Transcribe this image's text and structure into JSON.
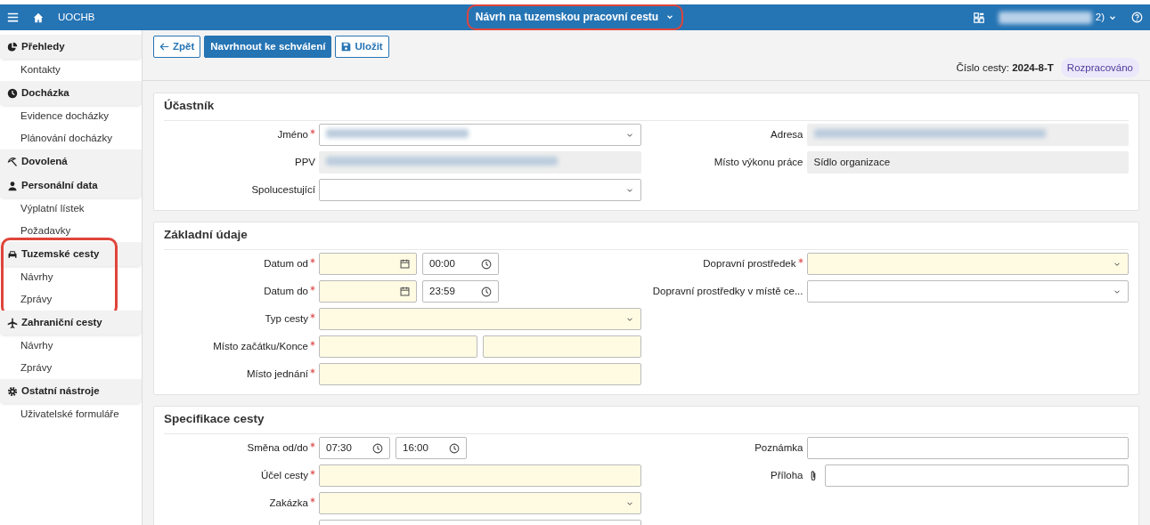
{
  "topbar": {
    "app_name": "UOCHB",
    "title": "Návrh na tuzemskou pracovní cestu",
    "title_highlighted": true,
    "user_redacted": true,
    "user_visible_text": "2)"
  },
  "sidebar": [
    {
      "label": "Přehledy",
      "highlighted": false,
      "items": [
        {
          "label": "Kontakty"
        }
      ]
    },
    {
      "label": "Docházka",
      "highlighted": false,
      "items": [
        {
          "label": "Evidence docházky"
        },
        {
          "label": "Plánování docházky"
        }
      ]
    },
    {
      "label": "Dovolená",
      "highlighted": false
    },
    {
      "label": "Personální data",
      "highlighted": false,
      "items": [
        {
          "label": "Výplatní lístek"
        },
        {
          "label": "Požadavky"
        }
      ]
    },
    {
      "label": "Tuzemské cesty",
      "highlighted": true,
      "items": [
        {
          "label": "Návrhy"
        },
        {
          "label": "Zprávy"
        }
      ]
    },
    {
      "label": "Zahraniční cesty",
      "highlighted": false,
      "items": [
        {
          "label": "Návrhy"
        },
        {
          "label": "Zprávy"
        }
      ]
    },
    {
      "label": "Ostatní nástroje",
      "highlighted": false,
      "items": [
        {
          "label": "Uživatelské formuláře"
        }
      ]
    }
  ],
  "toolbar": [
    {
      "label": "Zpět",
      "kind": "back"
    },
    {
      "label": "Navrhnout ke schválení",
      "kind": "primary"
    },
    {
      "label": "Uložit",
      "kind": "save"
    }
  ],
  "trip_number_label": "Číslo cesty:",
  "trip_number": "2024-8-T",
  "status": "Rozpracováno",
  "sections": [
    {
      "title": "Účastník",
      "left": [
        {
          "label": "Jméno",
          "required": true,
          "fields": [
            {
              "kind": "select",
              "redacted": true
            }
          ]
        },
        {
          "label": "PPV",
          "required": false,
          "fields": [
            {
              "kind": "readonly",
              "redacted": true
            }
          ]
        },
        {
          "label": "Spolucestující",
          "required": false,
          "fields": [
            {
              "kind": "select"
            }
          ]
        }
      ],
      "right": [
        {
          "label": "Adresa",
          "required": false,
          "fields": [
            {
              "kind": "readonly",
              "redacted": true
            }
          ]
        },
        {
          "label": "Místo výkonu práce",
          "required": false,
          "fields": [
            {
              "kind": "readonly",
              "value": "Sídlo organizace"
            }
          ]
        }
      ]
    },
    {
      "title": "Základní údaje",
      "left": [
        {
          "label": "Datum od",
          "required": true,
          "fields": [
            {
              "kind": "date"
            },
            {
              "kind": "time",
              "value": "00:00"
            }
          ]
        },
        {
          "label": "Datum do",
          "required": true,
          "fields": [
            {
              "kind": "date"
            },
            {
              "kind": "time",
              "value": "23:59"
            }
          ]
        },
        {
          "label": "Typ cesty",
          "required": true,
          "fields": [
            {
              "kind": "select"
            }
          ]
        },
        {
          "label": "Místo začátku/Konce",
          "required": true,
          "fields": [
            {
              "kind": "text"
            },
            {
              "kind": "text"
            }
          ]
        },
        {
          "label": "Místo jednání",
          "required": true,
          "fields": [
            {
              "kind": "text"
            }
          ]
        }
      ],
      "right": [
        {
          "label": "Dopravní prostředek",
          "required": true,
          "fields": [
            {
              "kind": "select"
            }
          ]
        },
        {
          "label": "Dopravní prostředky v místě ce...",
          "required": false,
          "fields": [
            {
              "kind": "select"
            }
          ]
        }
      ]
    },
    {
      "title": "Specifikace cesty",
      "left": [
        {
          "label": "Směna od/do",
          "required": true,
          "fields": [
            {
              "kind": "shorttime",
              "value": "07:30"
            },
            {
              "kind": "shorttime",
              "value": "16:00"
            }
          ]
        },
        {
          "label": "Účel cesty",
          "required": true,
          "fields": [
            {
              "kind": "text"
            }
          ]
        },
        {
          "label": "Zakázka",
          "required": true,
          "fields": [
            {
              "kind": "select"
            }
          ]
        },
        {
          "required": false,
          "fields": [
            {
              "kind": "text"
            }
          ]
        }
      ],
      "right": [
        {
          "label": "Poznámka",
          "required": false,
          "fields": [
            {
              "kind": "text"
            }
          ]
        },
        {
          "label": "Příloha",
          "required": false,
          "fields": [
            {
              "kind": "file"
            }
          ]
        }
      ]
    }
  ]
}
